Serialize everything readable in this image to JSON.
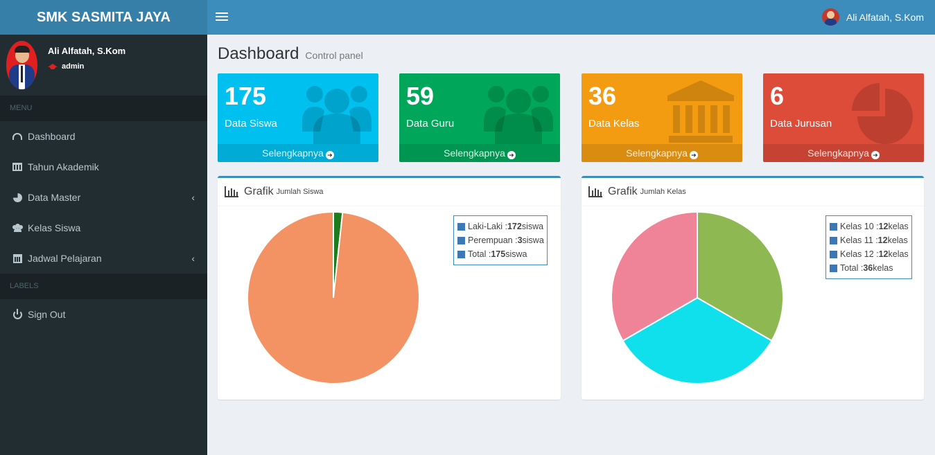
{
  "brand": "SMK SASMITA JAYA",
  "topbar": {
    "user_name": "Ali Alfatah, S.Kom"
  },
  "sidebar": {
    "user_name": "Ali Alfatah, S.Kom",
    "user_role": "admin",
    "menu_header": "MENU",
    "items": [
      {
        "label": "Dashboard",
        "icon": "dashboard-icon"
      },
      {
        "label": "Tahun Akademik",
        "icon": "bank-icon"
      },
      {
        "label": "Data Master",
        "icon": "pie-chart-icon",
        "has_children": true
      },
      {
        "label": "Kelas Siswa",
        "icon": "users-icon"
      },
      {
        "label": "Jadwal Pelajaran",
        "icon": "calendar-icon",
        "has_children": true
      }
    ],
    "labels_header": "LABELS",
    "signout": {
      "label": "Sign Out",
      "icon": "power-icon"
    }
  },
  "page": {
    "title": "Dashboard",
    "subtitle": "Control panel"
  },
  "stats": [
    {
      "value": "175",
      "label": "Data Siswa",
      "link": "Selengkapnya",
      "color": "#00c0ef",
      "icon": "users-icon"
    },
    {
      "value": "59",
      "label": "Data Guru",
      "link": "Selengkapnya",
      "color": "#00a65a",
      "icon": "users-icon"
    },
    {
      "value": "36",
      "label": "Data Kelas",
      "link": "Selengkapnya",
      "color": "#f39c12",
      "icon": "bank-icon"
    },
    {
      "value": "6",
      "label": "Data Jurusan",
      "link": "Selengkapnya",
      "color": "#dd4b39",
      "icon": "pie-chart-icon"
    }
  ],
  "panels": {
    "siswa": {
      "title": "Grafik",
      "subtitle": "Jumlah Siswa"
    },
    "kelas": {
      "title": "Grafik",
      "subtitle": "Jumlah Kelas"
    }
  },
  "chart_data": [
    {
      "type": "pie",
      "categories": [
        "Laki-Laki",
        "Perempuan"
      ],
      "values": [
        172,
        3
      ],
      "colors": [
        "#f39262",
        "#1e7b1e"
      ],
      "legend": [
        {
          "prefix": "Laki-Laki : ",
          "value": "172",
          "suffix": " siswa"
        },
        {
          "prefix": "Perempuan : ",
          "value": "3",
          "suffix": " siswa"
        },
        {
          "prefix": "Total : ",
          "value": "175",
          "suffix": " siswa"
        }
      ],
      "legend_position": "top-right"
    },
    {
      "type": "pie",
      "categories": [
        "Kelas 10",
        "Kelas 11",
        "Kelas 12"
      ],
      "values": [
        12,
        12,
        12
      ],
      "colors": [
        "#8db852",
        "#10e0ec",
        "#ef8397"
      ],
      "legend": [
        {
          "prefix": "Kelas 10 : ",
          "value": "12",
          "suffix": " kelas"
        },
        {
          "prefix": "Kelas 11 : ",
          "value": "12",
          "suffix": " kelas"
        },
        {
          "prefix": "Kelas 12 : ",
          "value": "12",
          "suffix": " kelas"
        },
        {
          "prefix": "Total : ",
          "value": "36",
          "suffix": " kelas"
        }
      ],
      "legend_position": "top-right"
    }
  ]
}
